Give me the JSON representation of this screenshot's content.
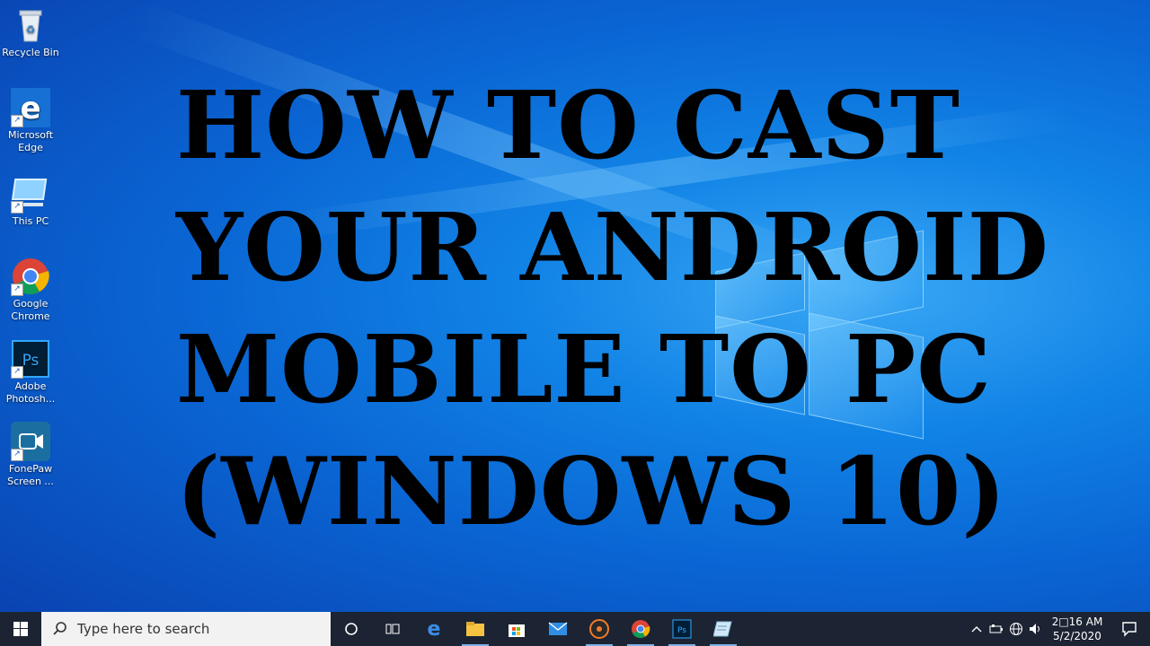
{
  "headline": "HOW TO CAST\nYOUR ANDROID\nMOBILE TO PC\n(WINDOWS 10)",
  "desktop_icons": [
    {
      "label": "Recycle Bin",
      "icon": "recycle-bin-icon"
    },
    {
      "label": "Microsoft Edge",
      "icon": "edge-icon"
    },
    {
      "label": "This PC",
      "icon": "this-pc-icon"
    },
    {
      "label": "Google Chrome",
      "icon": "chrome-icon"
    },
    {
      "label": "Adobe Photosh...",
      "icon": "photoshop-icon"
    },
    {
      "label": "FonePaw Screen ...",
      "icon": "fonepaw-icon"
    }
  ],
  "taskbar": {
    "search_placeholder": "Type here to search",
    "apps": [
      "task-view-icon",
      "edge-icon",
      "file-explorer-icon",
      "store-icon",
      "mail-icon",
      "media-player-icon",
      "chrome-icon",
      "photoshop-icon",
      "notepad-icon"
    ],
    "photoshop_label": "Ps",
    "clock_time": "2□16 AM",
    "clock_date": "5/2/2020"
  },
  "colors": {
    "taskbar": "#1c2433",
    "desktop": "#1183e6",
    "headline": "#000000"
  }
}
